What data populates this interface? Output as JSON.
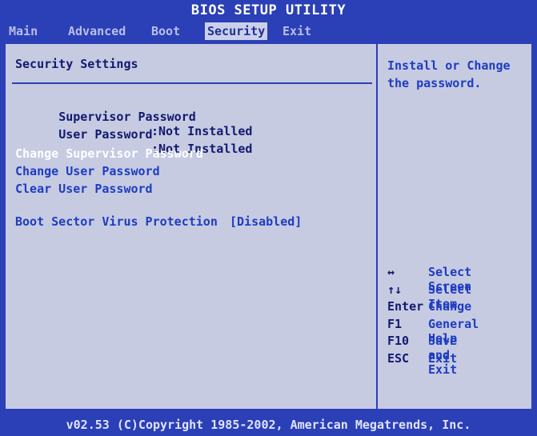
{
  "title": "BIOS SETUP UTILITY",
  "menu": [
    {
      "label": "Main",
      "active": false
    },
    {
      "label": "Advanced",
      "active": false
    },
    {
      "label": "Boot",
      "active": false
    },
    {
      "label": "Security",
      "active": true
    },
    {
      "label": "Exit",
      "active": false
    }
  ],
  "main": {
    "section_title": "Security Settings",
    "status_rows": [
      {
        "label": "Supervisor Password",
        "value": ":Not Installed"
      },
      {
        "label": "User Password",
        "value": ":Not Installed"
      }
    ],
    "actions": [
      {
        "label": "Change Supervisor Password",
        "selected": true
      },
      {
        "label": "Change User Password",
        "selected": false
      },
      {
        "label": "Clear User Password",
        "selected": false
      }
    ],
    "boot_sector": {
      "label": "Boot Sector Virus Protection",
      "value": "[Disabled]"
    }
  },
  "help": {
    "text": "Install or Change the password.",
    "keys": [
      {
        "key": "↔",
        "desc": "Select Screen"
      },
      {
        "key": "↑↓",
        "desc": "Select Item"
      },
      {
        "key": "Enter",
        "desc": "Change"
      },
      {
        "key": "F1",
        "desc": "General Help"
      },
      {
        "key": "F10",
        "desc": "Save and Exit"
      },
      {
        "key": "ESC",
        "desc": "Exit"
      }
    ]
  },
  "footer": "v02.53 (C)Copyright 1985-2002, American Megatrends, Inc.",
  "colors": {
    "background": "#2b3fb6",
    "panel": "#c6cbe2",
    "text_dark": "#13196e",
    "text_blue": "#1f3cc0",
    "selected": "#ffffff"
  }
}
